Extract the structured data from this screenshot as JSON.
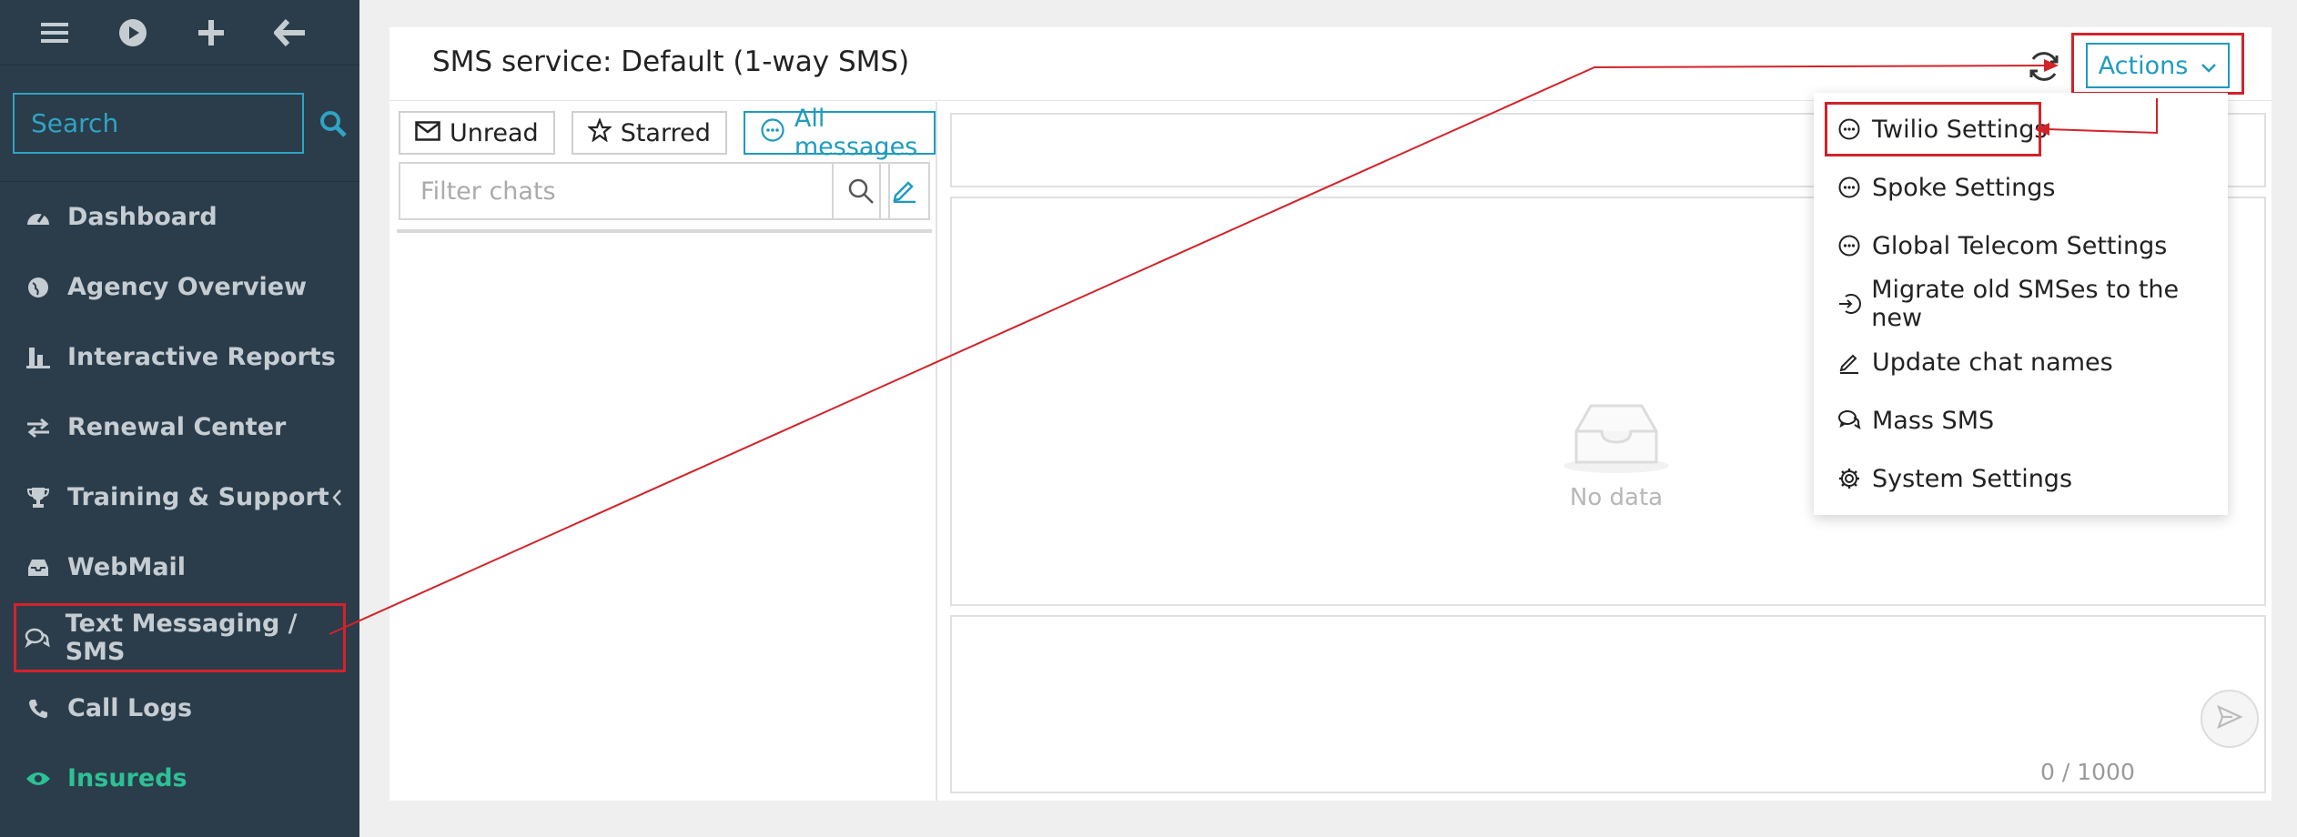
{
  "sidebar": {
    "search_placeholder": "Search",
    "items": [
      {
        "label": "Dashboard"
      },
      {
        "label": "Agency Overview"
      },
      {
        "label": "Interactive Reports"
      },
      {
        "label": "Renewal Center"
      },
      {
        "label": "Training & Support"
      },
      {
        "label": "WebMail"
      },
      {
        "label": "Text Messaging / SMS"
      },
      {
        "label": "Call Logs"
      },
      {
        "label": "Insureds"
      }
    ]
  },
  "main": {
    "title": "SMS service: Default (1-way SMS)",
    "actions_label": "Actions",
    "filters": {
      "unread": "Unread",
      "starred": "Starred",
      "all": "All messages"
    },
    "chat_filter_placeholder": "Filter chats",
    "empty_text": "No data",
    "char_counter": "0 / 1000"
  },
  "actions_menu": {
    "items": [
      {
        "label": "Twilio Settings",
        "icon": "chat-icon"
      },
      {
        "label": "Spoke Settings",
        "icon": "chat-icon"
      },
      {
        "label": "Global Telecom Settings",
        "icon": "chat-icon"
      },
      {
        "label": "Migrate old SMSes to the new",
        "icon": "login-icon"
      },
      {
        "label": "Update chat names",
        "icon": "edit-icon"
      },
      {
        "label": "Mass SMS",
        "icon": "messages-icon"
      },
      {
        "label": "System Settings",
        "icon": "gear-icon"
      }
    ]
  },
  "colors": {
    "sidebar_bg": "#2b3c4a",
    "accent": "#1f9bbf",
    "active_nav": "#2cc196",
    "highlight": "#d2232a"
  }
}
